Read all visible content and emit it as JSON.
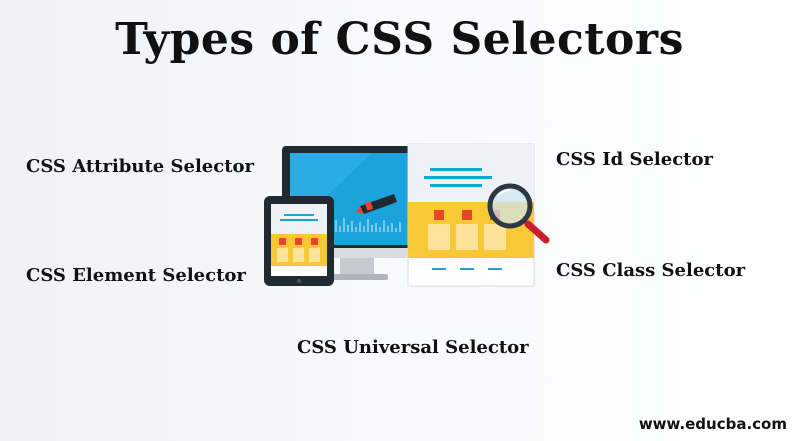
{
  "title": "Types of CSS Selectors",
  "labels": {
    "attribute": "CSS Attribute Selector",
    "element": "CSS Element Selector",
    "id": "CSS Id Selector",
    "class": "CSS Class Selector",
    "universal": "CSS Universal Selector"
  },
  "watermark": "www.educba.com",
  "colors": {
    "screen_blue": "#1ba3dc",
    "device_dark": "#1f2a33",
    "accent_yellow": "#f7c934",
    "accent_red": "#e8452c",
    "magnifier_red": "#c8202a"
  },
  "icons": [
    "monitor-icon",
    "tablet-icon",
    "webpage-icon",
    "magnifier-icon",
    "pen-icon"
  ]
}
